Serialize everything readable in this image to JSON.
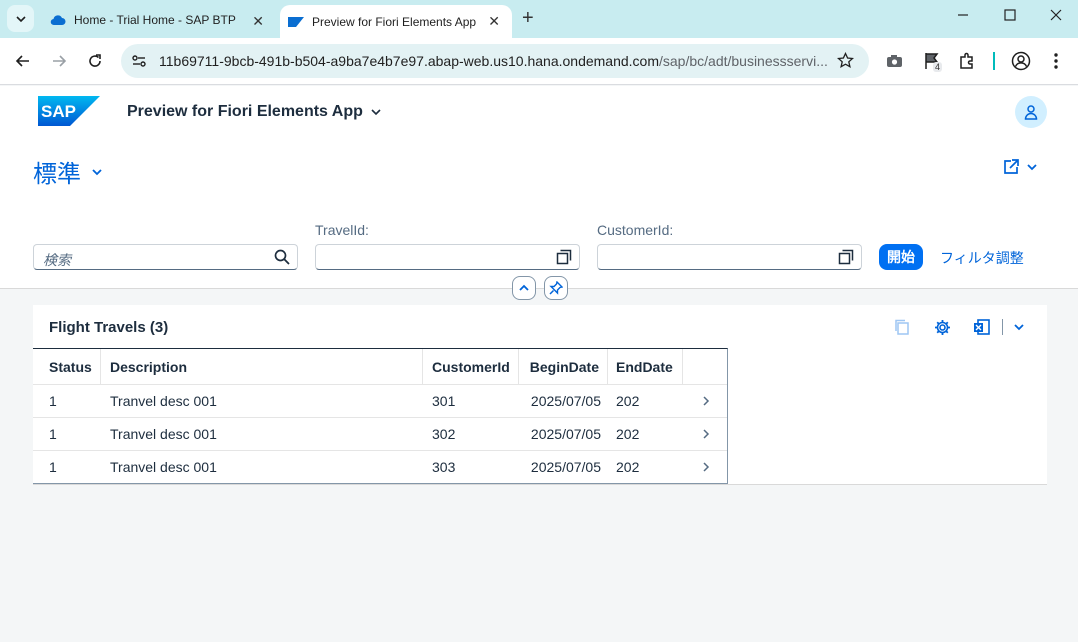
{
  "browser": {
    "tabs": [
      {
        "title": "Home - Trial Home - SAP BTP C",
        "active": false
      },
      {
        "title": "Preview for Fiori Elements App",
        "active": true
      }
    ],
    "url_main": "11b69711-9bcb-491b-b504-a9ba7e4b7e97.abap-web.us10.hana.ondemand.com",
    "url_path": "/sap/bc/adt/businessservi...",
    "extension_badge": "4"
  },
  "shell": {
    "app_title": "Preview for Fiori Elements App",
    "logo_text": "SAP"
  },
  "header": {
    "variant_name": "標準",
    "search_placeholder": "検索",
    "filters": [
      {
        "label": "TravelId:",
        "value": ""
      },
      {
        "label": "CustomerId:",
        "value": ""
      }
    ],
    "go_label": "開始",
    "adapt_label": "フィルタ調整"
  },
  "table": {
    "title": "Flight Travels (3)",
    "columns": [
      "Status",
      "Description",
      "CustomerId",
      "BeginDate",
      "EndDate"
    ],
    "rows": [
      {
        "status": "1",
        "description": "Tranvel desc 001",
        "customer": "301",
        "begin": "2025/07/05",
        "end": "202"
      },
      {
        "status": "1",
        "description": "Tranvel desc 001",
        "customer": "302",
        "begin": "2025/07/05",
        "end": "202"
      },
      {
        "status": "1",
        "description": "Tranvel desc 001",
        "customer": "303",
        "begin": "2025/07/05",
        "end": "202"
      }
    ]
  },
  "colors": {
    "accent": "#0070f2",
    "link": "#0064d9",
    "chrome": "#c8ecf0"
  }
}
